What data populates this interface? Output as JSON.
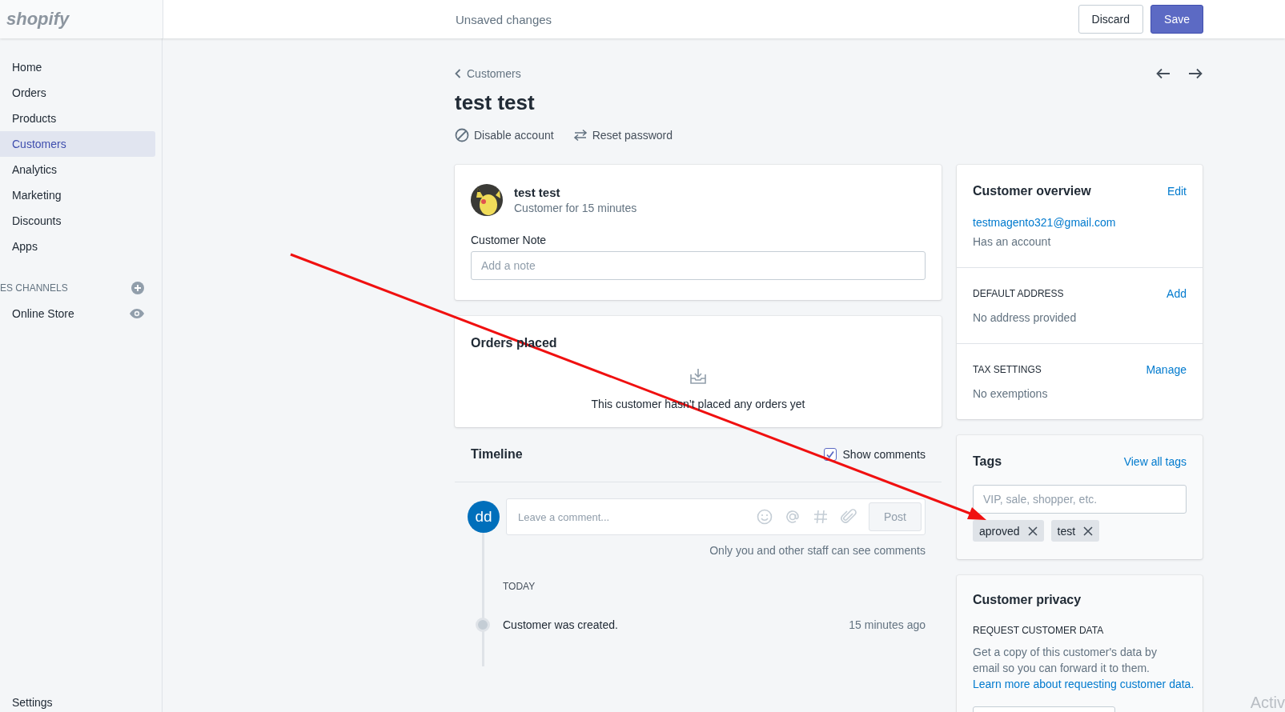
{
  "topbar": {
    "logo": "shopify",
    "status": "Unsaved changes",
    "buttons": [
      {
        "label": "Discard",
        "kind": "secondary"
      },
      {
        "label": "Save",
        "kind": "primary"
      }
    ]
  },
  "sidebar": {
    "items": [
      {
        "label": "Home",
        "selected": false
      },
      {
        "label": "Orders",
        "selected": false
      },
      {
        "label": "Products",
        "selected": false
      },
      {
        "label": "Customers",
        "selected": true
      },
      {
        "label": "Analytics",
        "selected": false
      },
      {
        "label": "Marketing",
        "selected": false
      },
      {
        "label": "Discounts",
        "selected": false
      },
      {
        "label": "Apps",
        "selected": false
      }
    ],
    "section": "ES CHANNELS",
    "channels": [
      {
        "label": "Online Store"
      }
    ],
    "footer": "Settings"
  },
  "page": {
    "breadcrumb": "Customers",
    "title": "test test",
    "actions": [
      {
        "label": "Disable account",
        "kind": "disable"
      },
      {
        "label": "Reset password",
        "kind": "reset"
      }
    ]
  },
  "customer_card": {
    "name": "test test",
    "since": "Customer for 15 minutes",
    "note": {
      "label": "Customer Note",
      "placeholder": "Add a note"
    }
  },
  "orders_card": {
    "title": "Orders placed",
    "message": "This customer hasn’t placed any orders yet"
  },
  "timeline": {
    "title": "Timeline",
    "show_comments": {
      "label": "Show comments",
      "checked": true
    },
    "avatar": "dd",
    "comment": {
      "placeholder": "Leave a comment...",
      "button": "Post"
    },
    "note": "Only you and other staff can see comments",
    "groups": [
      {
        "label": "TODAY",
        "events": [
          {
            "text": "Customer was created.",
            "time": "15 minutes ago"
          }
        ]
      }
    ]
  },
  "overview": {
    "title": "Customer overview",
    "action": "Edit",
    "email": "testmagento321@gmail.com",
    "account": "Has an account",
    "sections": [
      {
        "title": "DEFAULT ADDRESS",
        "action": "Add",
        "text": "No address provided"
      },
      {
        "title": "TAX SETTINGS",
        "action": "Manage",
        "text": "No exemptions"
      }
    ]
  },
  "tags": {
    "title": "Tags",
    "action": "View all tags",
    "placeholder": "VIP, sale, shopper, etc.",
    "items": [
      "aproved",
      "test"
    ]
  },
  "privacy": {
    "title": "Customer privacy",
    "heading": "REQUEST CUSTOMER DATA",
    "text": "Get a copy of this customer's data by email so you can forward it to them.",
    "link": "Learn more about requesting customer data."
  },
  "overlay": {
    "activation": "Activ"
  }
}
